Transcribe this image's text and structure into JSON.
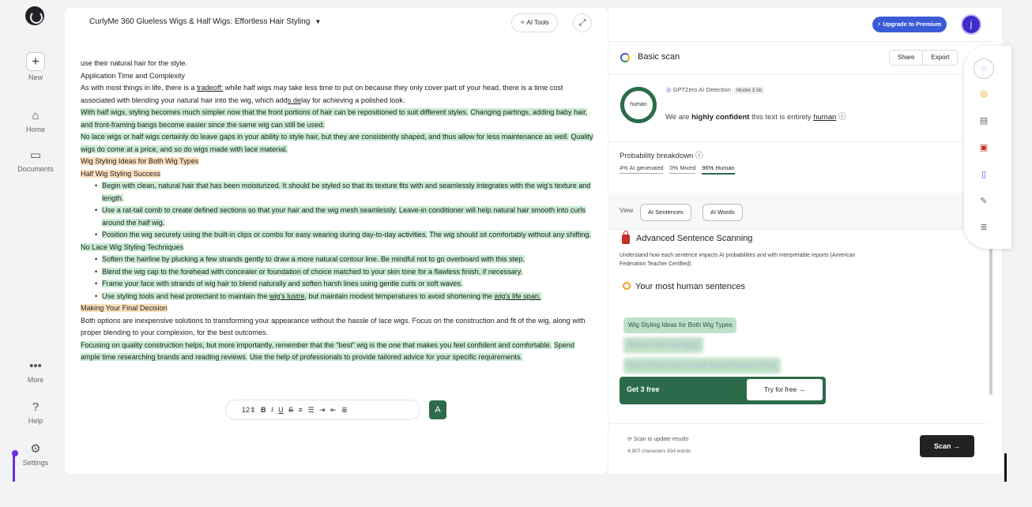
{
  "nav": {
    "new_label": "New",
    "home_label": "Home",
    "documents_label": "Documents",
    "more_label": "More",
    "help_label": "Help",
    "settings_label": "Settings"
  },
  "editor": {
    "doc_title": "CurlyMe 360 Glueless Wigs & Half Wigs: Effortless Hair Styling",
    "ai_tools_label": "AI Tools",
    "font_size": "12"
  },
  "doc": {
    "l1": "use their natural hair for the style.",
    "l2": "Application Time and Complexity",
    "l3a": "As with most things in life, there is a ",
    "l3b": "tradeoff:",
    "l3c": " while half wigs may take less time to put on because they only cover part of your head, there is a time cost associated with blending your natural hair into the wig, which add",
    "l3d": "s de",
    "l3e": "lay for achieving a polished look.",
    "l4a": "With half wigs, styling becomes much simpler now that the front portions of hair can be repositioned to suit different styles.",
    "l4b": "Changing partings, adding baby hair, and front-framing bangs become easier since the same wig can still be used.",
    "l5a": "No lace wigs or half wigs certainly do leave gaps in your ability to style hair, but they are consistently shaped, and thus allow for less maintenance as well.",
    "l5b": "Quality wigs do come at a price, and so do wigs made with lace material.",
    "h1": "Wig Styling Ideas for Both Wig Types",
    "h2": "Half Wig Styling Success",
    "b1": "Begin with clean, natural hair that has been moisturized. It should be styled so that its texture fits with and seamlessly integrates with the wig's texture and length.",
    "b2a": "Use a rat-tail comb to create defined sections so that your hair and the wig mesh seamlessly.",
    "b2b": "Leave-in conditioner will help natural hair smooth into curls around the half wig.",
    "b3a": "Position the wig securely using the built-in clips or combs for easy wearing during day-to-day activities.",
    "b3b": "The wig should sit comfortably without any shifting.",
    "h3": "No Lace Wig Styling Techniques",
    "c1": "Soften the hairline by plucking a few strands gently to draw a more natural contour line. Be mindful not to go overboard with this step.",
    "c2": "Blend the wig cap to the forehead with concealer or foundation of choice matched to your skin tone for a flawless finish, if necessary.",
    "c3": "Frame your face with strands of wig hair to blend naturally and soften harsh lines using gentle curls or soft waves.",
    "c4a": "Use styling tools and heat protectant to maintain the ",
    "c4b": "wig's lustre",
    "c4c": ", but maintain modest temperatures to avoid shortening the ",
    "c4d": "wig's life span.",
    "h4": "Making Your Final Decision",
    "p1": "Both options are inexpensive solutions to transforming your appearance without the hassle of lace wigs. Focus on the construction and fit of the wig, along with proper blending to your complexion, for the best outcomes.",
    "p2a": "Focusing on quality construction helps, but more importantly, remember that the \"best\" wig is the one that makes you feel confident and comfortable.",
    "p2b": "Spend ample time researching brands and reading reviews.",
    "p2c": "Use the help of professionals to provide tailored advice for your specific requirements."
  },
  "panel": {
    "upgrade_label": "Upgrade to Premium",
    "avatar_letter": "j",
    "scan_title": "Basic scan",
    "share_label": "Share",
    "export_label": "Export",
    "ring_label": "human",
    "detector": "GPTZero AI Detection",
    "model_badge": "Model 3.5b",
    "conf_a": "We are ",
    "conf_b": "highly confident",
    "conf_c": " this text is entirely ",
    "conf_d": "human",
    "prob_heading": "Probability breakdown",
    "prob_ai": "4% AI generated",
    "prob_mixed": "0% Mixed",
    "prob_human": "96% Human",
    "view_label": "View",
    "view_sentences": "AI Sentences",
    "view_words": "AI Words",
    "adv_title": "Advanced Sentence Scanning",
    "adv_desc": "Understand how each sentence impacts AI probabilities and with interpretable reports (American Federation Teacher Certified)",
    "most_human": "Your most human sentences",
    "chip1": "Wig Styling Ideas for Both Wig Types",
    "chip2": "What Are No Lace Wigs?",
    "chip3": "Use a rat-tail comb to create defined sections so that",
    "get_free": "Get 3 free",
    "try_free": "Try for free →",
    "update_hint": "Scan to update results",
    "counts": "4,907 characters 834 words",
    "scan_btn": "Scan →"
  },
  "colors": {
    "accent_green": "#2b6b4a",
    "highlight_green": "#c9ecd3",
    "highlight_orange": "#fbe0bb",
    "premium_blue": "#3b5bd6"
  }
}
